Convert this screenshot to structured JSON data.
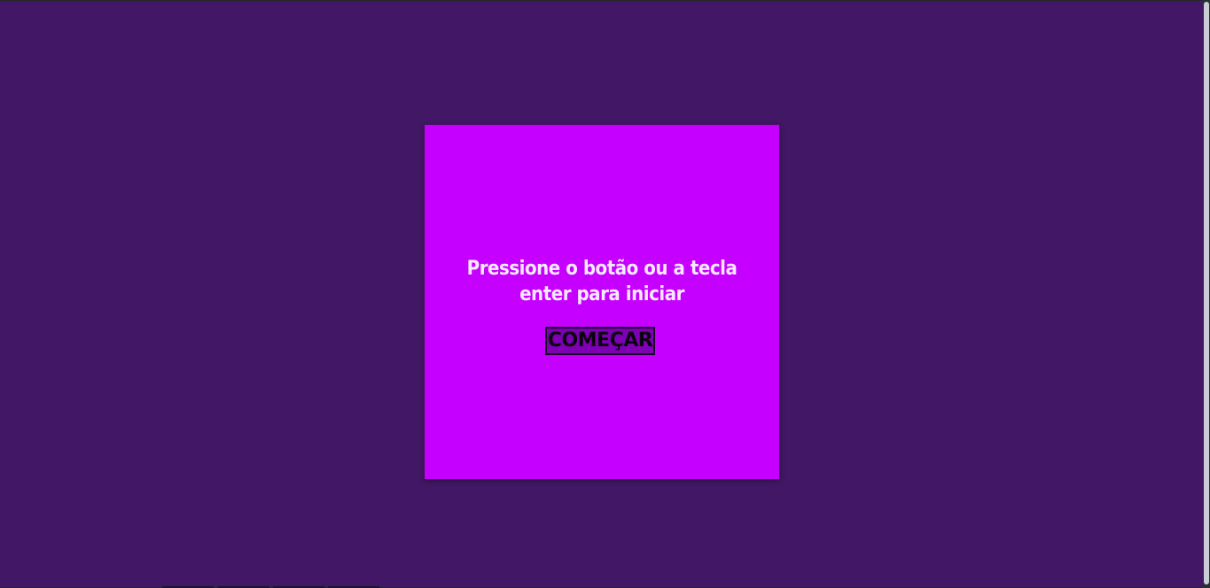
{
  "game": {
    "message": "Pressione o botão ou a tecla enter para iniciar",
    "start_button_label": "COMEÇAR"
  },
  "colors": {
    "page_background": "#421765",
    "game_background": "#c600ff",
    "message_text": "#f5e9ff",
    "button_background": "#7d00b5",
    "button_border": "#1a0024"
  }
}
